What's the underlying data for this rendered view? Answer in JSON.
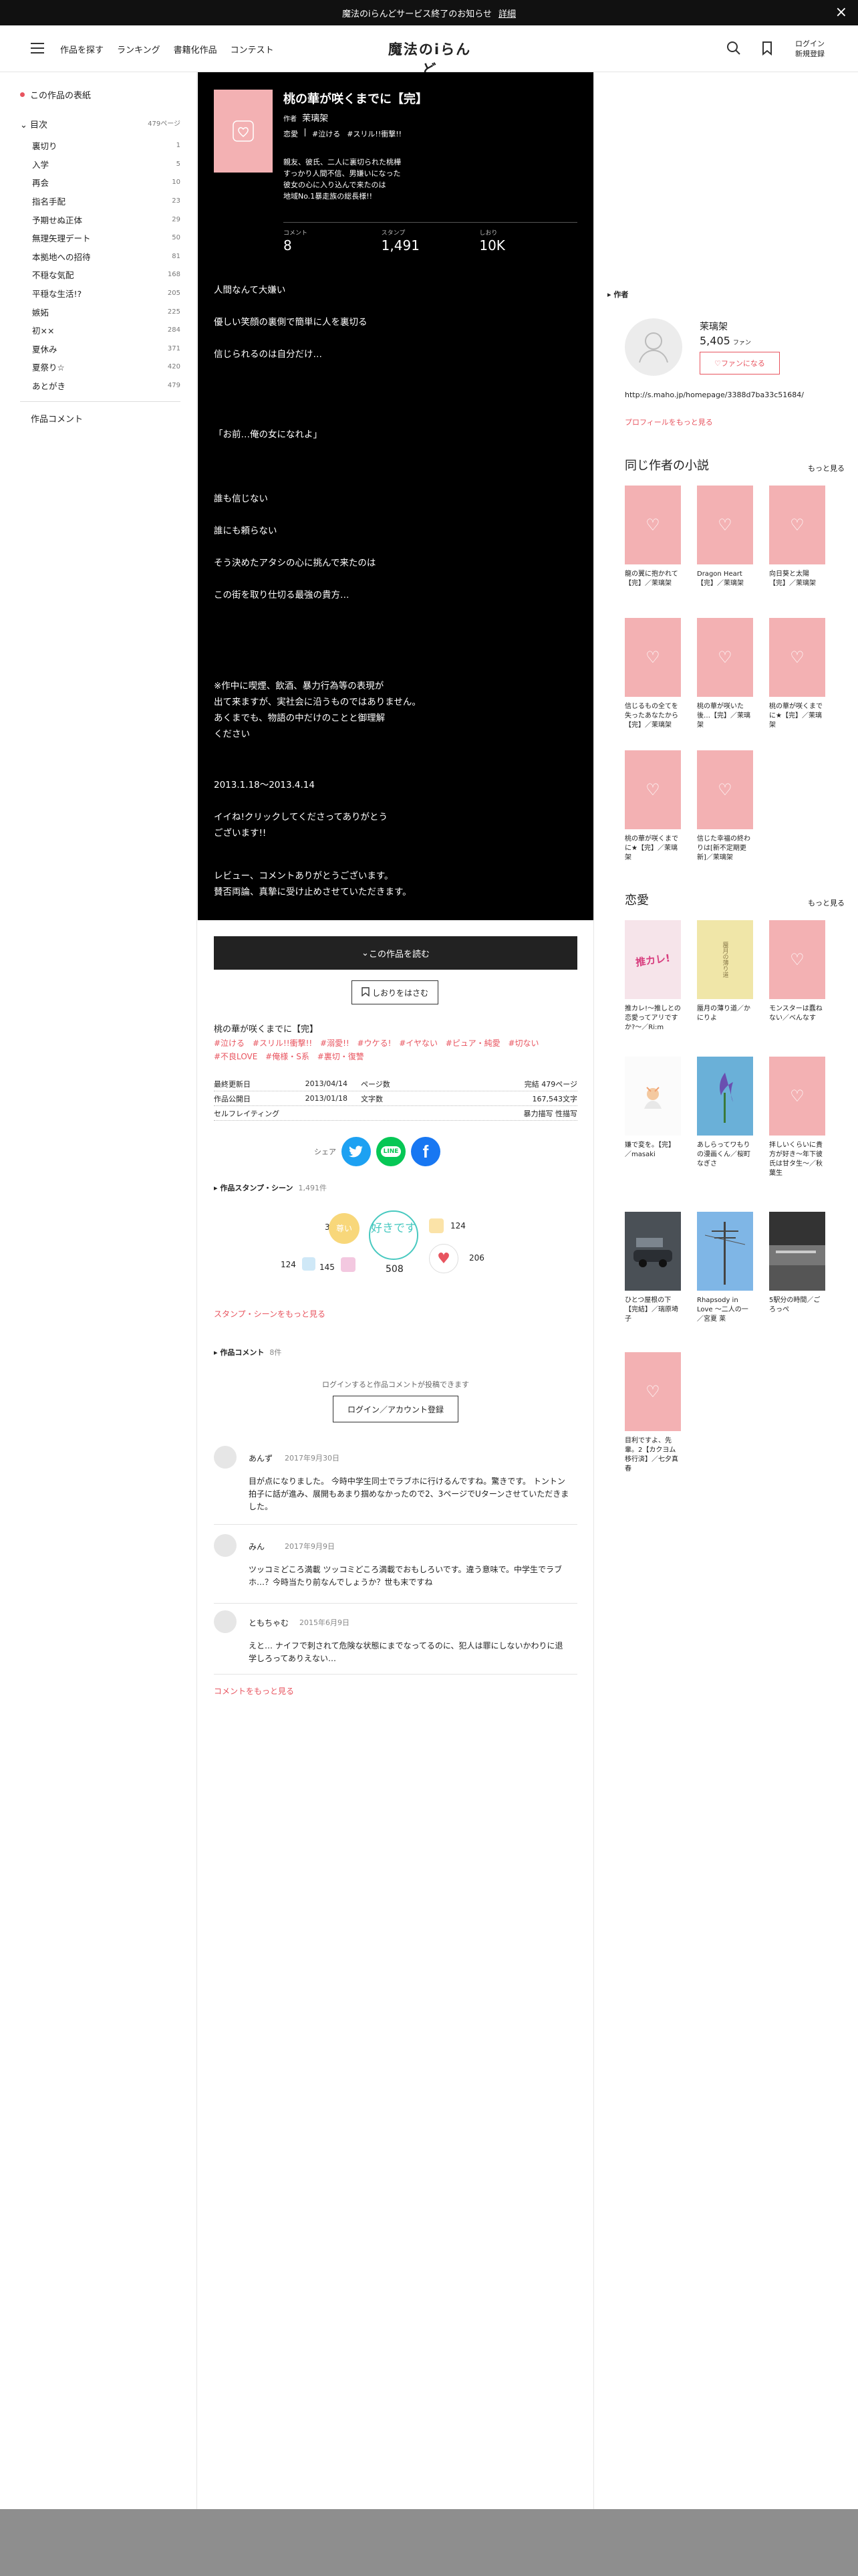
{
  "notice": {
    "text": "魔法のiらんどサービス終了のお知らせ",
    "link": "詳細"
  },
  "header": {
    "nav": [
      "作品を探す",
      "ランキング",
      "書籍化作品",
      "コンテスト"
    ],
    "logo": "魔法のiらんど",
    "login": "ログイン",
    "signup": "新規登録"
  },
  "sidebar": {
    "cover_link": "この作品の表紙",
    "toc_label": "目次",
    "toc_pages": "479ページ",
    "chapters": [
      {
        "title": "裏切り",
        "page": "1"
      },
      {
        "title": "入学",
        "page": "5"
      },
      {
        "title": "再会",
        "page": "10"
      },
      {
        "title": "指名手配",
        "page": "23"
      },
      {
        "title": "予期せぬ正体",
        "page": "29"
      },
      {
        "title": "無理矢理デート",
        "page": "50"
      },
      {
        "title": "本拠地への招待",
        "page": "81"
      },
      {
        "title": "不穏な気配",
        "page": "168"
      },
      {
        "title": "平穏な生活!?",
        "page": "205"
      },
      {
        "title": "嫉妬",
        "page": "225"
      },
      {
        "title": "初××",
        "page": "284"
      },
      {
        "title": "夏休み",
        "page": "371"
      },
      {
        "title": "夏祭り☆",
        "page": "420"
      },
      {
        "title": "あとがき",
        "page": "479"
      }
    ],
    "comment_link": "作品コメント"
  },
  "work": {
    "title": "桃の華が咲くまでに【完】",
    "author_label": "作者",
    "author": "茉璃架",
    "genre": "恋愛",
    "tags": [
      "#泣ける",
      "#スリル!!衝撃!!"
    ],
    "description": [
      "親友、彼氏、二人に裏切られた桃樺",
      "すっかり人間不信、男嫌いになった",
      "彼女の心に入り込んで来たのは",
      "地域No.1暴走族の総長様!!"
    ],
    "stats": [
      {
        "label": "コメント",
        "value": "8"
      },
      {
        "label": "スタンプ",
        "value": "1,491"
      },
      {
        "label": "しおり",
        "value": "10K"
      }
    ],
    "body": {
      "p1": [
        "人間なんて大嫌い"
      ],
      "p2": [
        "優しい笑顔の裏側で簡単に人を裏切る"
      ],
      "p3": [
        "信じられるのは自分だけ…"
      ],
      "p4": [
        "「お前…俺の女になれよ」"
      ],
      "p5": [
        "誰も信じない"
      ],
      "p6": [
        "誰にも頼らない"
      ],
      "p7": [
        "そう決めたアタシの心に挑んで来たのは"
      ],
      "p8": [
        "この街を取り仕切る最強の貴方…"
      ],
      "p9": [
        "※作中に喫煙、飲酒、暴力行為等の表現が",
        "出て来ますが、実社会に沿うものではありません。",
        "あくまでも、物語の中だけのことと御理解",
        "ください"
      ],
      "p10": [
        "2013.1.18〜2013.4.14"
      ],
      "p11": [
        "イイね!クリックしてくださってありがとう",
        "ございます!!"
      ],
      "p12": [
        "レビュー、コメントありがとうございます。",
        "賛否両論、真摯に受け止めさせていただきます。"
      ]
    }
  },
  "actions": {
    "read": "この作品を読む",
    "bookmark": "しおりをはさむ"
  },
  "details": {
    "subtitle": "桃の華が咲くまでに【完】",
    "tags": [
      "#泣ける",
      "#スリル!!衝撃!!",
      "#溺愛!!",
      "#ウケる!",
      "#イヤない",
      "#ピュア・純愛",
      "#切ない",
      "#不良LOVE",
      "#俺様・S系",
      "#裏切・復讐"
    ],
    "rows": [
      {
        "k": "最終更新日",
        "v": "2013/04/14",
        "k2": "ページ数",
        "v2": "完結 479ページ"
      },
      {
        "k": "作品公開日",
        "v": "2013/01/18",
        "k2": "文字数",
        "v2": "167,543文字"
      },
      {
        "k": "セルフレイティング",
        "v": "",
        "k2": "",
        "v2": "暴力描写 性描写"
      }
    ]
  },
  "share": {
    "label": "シェア",
    "line": "LINE"
  },
  "stamps": {
    "heading": "作品スタンプ・シーン",
    "count": "1,491件",
    "items": [
      {
        "label": "尊い",
        "count": "384"
      },
      {
        "label": "好きです",
        "count": "508"
      },
      {
        "label": "泣ける",
        "count": "124"
      },
      {
        "label": "ドキドキ",
        "count": "124"
      },
      {
        "label": "ウケる",
        "count": "145"
      },
      {
        "label": "ハート",
        "count": "206"
      }
    ],
    "more": "スタンプ・シーンをもっと見る"
  },
  "comments": {
    "heading": "作品コメント",
    "count": "8件",
    "login_note": "ログインすると作品コメントが投稿できます",
    "login_button": "ログイン／アカウント登録",
    "items": [
      {
        "name": "あんず",
        "date": "2017年9月30日",
        "text": "目が点になりました。 今時中学生同士でラブホに行けるんですね。驚きです。 トントン拍子に話が進み、展開もあまり掴めなかったので2、3ページでUターンさせていただきました。"
      },
      {
        "name": "みん",
        "date": "2017年9月9日",
        "text": "ツッコミどころ満載 ツッコミどころ満載でおもしろいです。違う意味で。中学生でラブホ…？今時当たり前なんでしょうか？世も末ですね"
      },
      {
        "name": "ともちゃむ",
        "date": "2015年6月9日",
        "text": "えと… ナイフで刺されて危険な状態にまでなってるのに、犯人は罪にしないかわりに退学しろってありえない…"
      }
    ],
    "more": "コメントをもっと見る"
  },
  "author_box": {
    "heading": "作者",
    "name": "茉璃架",
    "fans": "5,405",
    "fans_unit": "ファン",
    "fan_button": "ファンになる",
    "url": "http://s.maho.jp/homepage/3388d7ba33c51684/",
    "profile_link": "プロフィールをもっと見る"
  },
  "same_author": {
    "title": "同じ作者の小説",
    "more": "もっと見る",
    "books": [
      "龍の翼に抱かれて【完】／茉璃架",
      "Dragon Heart【完】／茉璃架",
      "向日葵と太陽【完】／茉璃架",
      "信じるもの全てを失ったあなたから【完】／茉璃架",
      "桃の華が咲いた後…【完】／茉璃架",
      "桃の華が咲くまでに★【完】／茉璃架",
      "桃の華が咲くまでに★【完】／茉璃架",
      "信じた幸福の終わりは[新不定期更新]／茉璃架"
    ]
  },
  "romance": {
    "title": "恋愛",
    "more": "もっと見る",
    "books": [
      "推カレ!〜推しとの恋愛ってアリですか?〜／Ri:m",
      "蜃月の薄り道／かにりよ",
      "モンスターは蠢ねない／べんなす",
      "嫌で変を。【完】／masaki",
      "あしらってワもりの漫画くん／桜町なぎさ",
      "拝しいくらいに貴方が好き〜年下彼氏は甘タ生〜／秋葉生",
      "ひとつ屋根の下【完結】／瑞原埼子",
      "Rhapsody in Love 〜二人の一／宮夏 莱",
      "5駅分の時間／ごろっぺ",
      "目利ですよ、先輩。2【カクヨム移行済】／七夕真春"
    ],
    "cover_text": "推カレ!",
    "cover_text2": "蜃月の薄り道"
  },
  "colors": {
    "accent": "#e8545f",
    "cover_pink": "#f3b1b3",
    "panel_black": "#000000"
  }
}
